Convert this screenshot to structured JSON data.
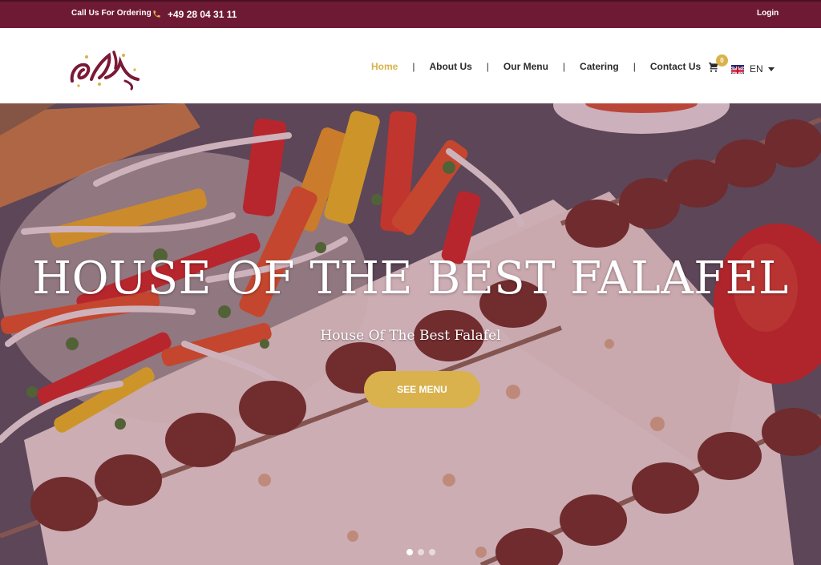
{
  "topbar": {
    "call_label": "Call Us For Ordering",
    "phone": "+49 28 04 31 11",
    "login": "Login"
  },
  "header": {
    "nav": [
      {
        "label": "Home",
        "active": true
      },
      {
        "label": "About Us",
        "active": false
      },
      {
        "label": "Our Menu",
        "active": false
      },
      {
        "label": "Catering",
        "active": false
      },
      {
        "label": "Contact Us",
        "active": false
      }
    ],
    "cart_count": "0",
    "language": "EN"
  },
  "hero": {
    "title": "HOUSE OF THE BEST FALAFEL",
    "subtitle": "House Of The Best Falafel",
    "cta": "SEE MENU",
    "slides": 3,
    "active_slide": 1
  },
  "colors": {
    "topbar": "#6e1a35",
    "accent": "#d8b24a",
    "nav_text": "#2b2b2b"
  }
}
